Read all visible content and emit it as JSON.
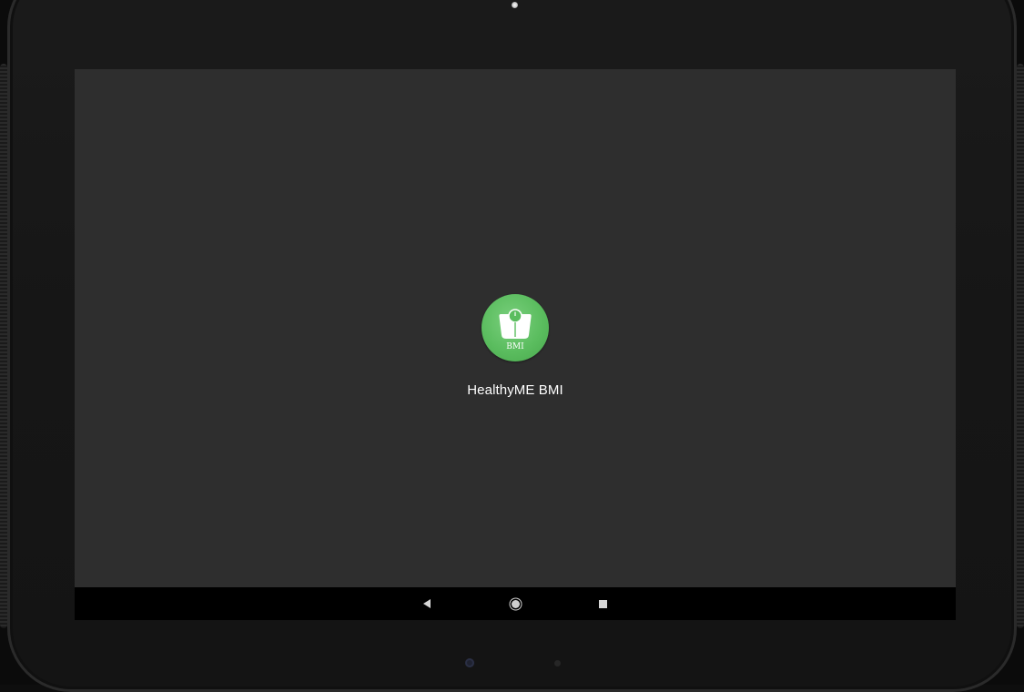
{
  "launcher": {
    "app_label": "HealthyME BMI",
    "icon_text": "BMI",
    "icon_name": "bmi-scale-icon",
    "icon_bg_color": "#5bbd5f"
  },
  "navigation_bar": {
    "back_icon": "back-triangle-icon",
    "home_icon": "home-circle-icon",
    "recents_icon": "recents-square-icon"
  }
}
